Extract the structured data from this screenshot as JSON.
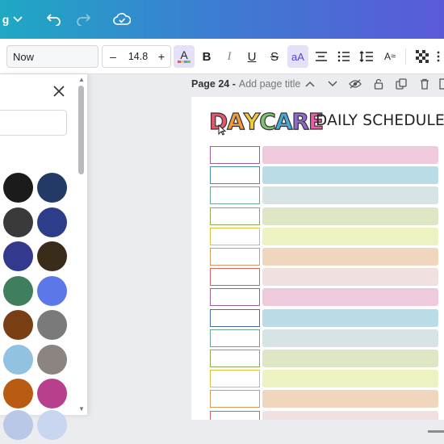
{
  "topbar": {
    "resize_label": "g",
    "icons": [
      "chevron-down-icon",
      "undo-icon",
      "redo-icon",
      "cloud-saved-icon"
    ]
  },
  "toolbar": {
    "font_name": "Now",
    "font_size": "14.8",
    "minus": "–",
    "plus": "+",
    "text_color_label": "A",
    "bold_label": "B",
    "italic_label": "I",
    "underline_label": "U",
    "strike_label": "S",
    "case_label": "aA",
    "effects_label": "A"
  },
  "panel": {
    "swatches": [
      "#1b1b1b",
      "#233a66",
      "#3a3a3a",
      "#2e3d8a",
      "#33398c",
      "#3a2c1a",
      "#3f7f5e",
      "#5b77e8",
      "#7a3e14",
      "#7a7a7a",
      "#92c2e2",
      "#8b8480",
      "#b85c14",
      "#b83f8c"
    ]
  },
  "canvas": {
    "page_number": "Page 24 -",
    "page_title_placeholder": "Add page title",
    "title_letters": [
      "D",
      "A",
      "Y",
      "C",
      "A",
      "R",
      "E"
    ],
    "title_colors": [
      "#e8546b",
      "#f19a3e",
      "#f0c93c",
      "#7cc472",
      "#4aa8d8",
      "#8f6bd0",
      "#e35fa7"
    ],
    "subtitle": "DAILY SCHEDULE",
    "rows": [
      {
        "box": "#a0609a",
        "bar": "#efc9dc"
      },
      {
        "box": "#4a8fa8",
        "bar": "#b9dce6"
      },
      {
        "box": "#6aa88f",
        "bar": "#d6e4e6"
      },
      {
        "box": "#8fa858",
        "bar": "#dfe6c4"
      },
      {
        "box": "#d8c23c",
        "bar": "#eef2c2"
      },
      {
        "box": "#d89a58",
        "bar": "#f0d6bd"
      },
      {
        "box": "#d86068",
        "bar": "#f1e0e0"
      },
      {
        "box": "#a0609a",
        "bar": "#efc9dc"
      },
      {
        "box": "#4a6fa8",
        "bar": "#b9dce6"
      },
      {
        "box": "#6aa88f",
        "bar": "#d6e4e6"
      },
      {
        "box": "#8fa858",
        "bar": "#dfe6c4"
      },
      {
        "box": "#d8c23c",
        "bar": "#eef2c2"
      },
      {
        "box": "#d89a58",
        "bar": "#f0d6bd"
      },
      {
        "box": "#d86068",
        "bar": "#f1e0e0"
      }
    ]
  }
}
